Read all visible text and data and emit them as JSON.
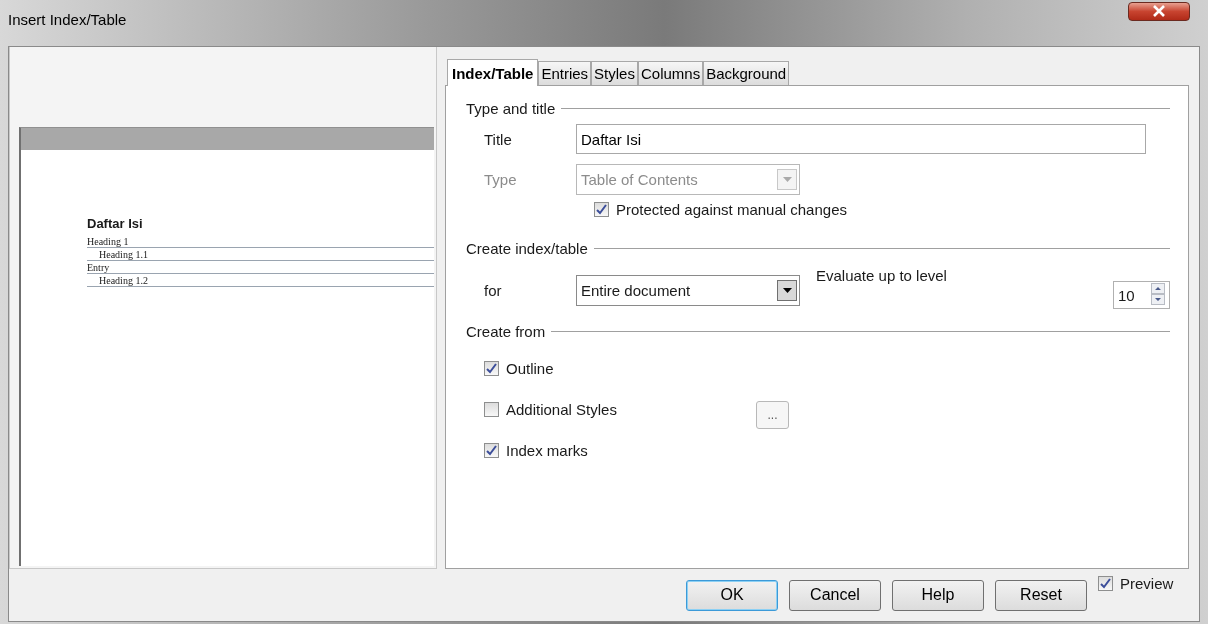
{
  "window": {
    "title": "Insert Index/Table"
  },
  "preview": {
    "heading": "Daftar Isi",
    "entries": [
      {
        "text": "Heading 1",
        "children": [
          {
            "text": "Heading 1.1"
          }
        ]
      },
      {
        "text": "Entry",
        "children": [
          {
            "text": "Heading 1.2"
          }
        ]
      }
    ]
  },
  "tabs": [
    {
      "label": "Index/Table",
      "selected": true
    },
    {
      "label": "Entries",
      "selected": false
    },
    {
      "label": "Styles",
      "selected": false
    },
    {
      "label": "Columns",
      "selected": false
    },
    {
      "label": "Background",
      "selected": false
    }
  ],
  "type_and_title": {
    "heading": "Type and title",
    "title_field": {
      "label": "Title",
      "value": "Daftar Isi"
    },
    "type_field": {
      "label": "Type",
      "value": "Table of Contents",
      "disabled": true
    },
    "protected": {
      "label": "Protected against manual changes",
      "checked": true
    }
  },
  "create_index": {
    "heading": "Create index/table",
    "for_field": {
      "label": "for",
      "value": "Entire document"
    },
    "evaluate": {
      "label": "Evaluate up to level",
      "value": "10"
    }
  },
  "create_from": {
    "heading": "Create from",
    "options": [
      {
        "label": "Outline",
        "checked": true
      },
      {
        "label": "Additional Styles",
        "checked": false
      },
      {
        "label": "Index marks",
        "checked": true
      }
    ],
    "styles_button": "..."
  },
  "buttons": [
    {
      "label": "OK",
      "default": true
    },
    {
      "label": "Cancel",
      "default": false
    },
    {
      "label": "Help",
      "default": false
    },
    {
      "label": "Reset",
      "default": false
    }
  ],
  "preview_toggle": {
    "label": "Preview",
    "checked": true
  }
}
